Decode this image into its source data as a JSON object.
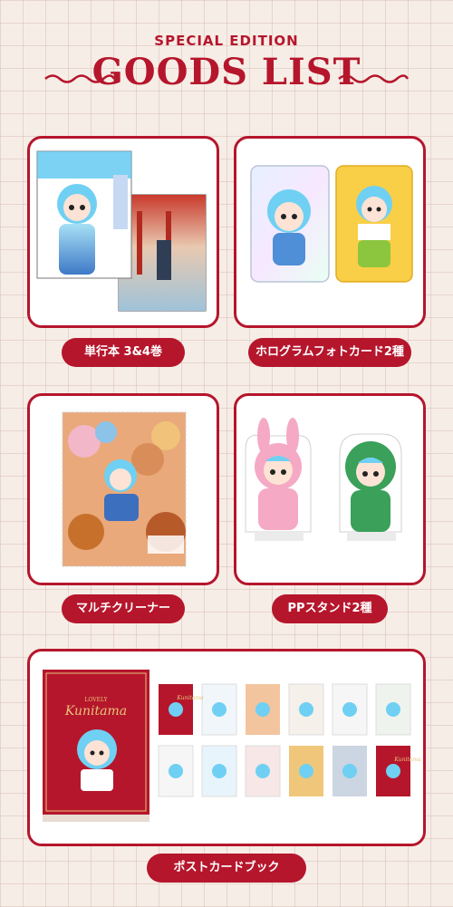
{
  "header": {
    "subtitle": "SPECIAL EDITION",
    "title": "GOODS LIST"
  },
  "items": [
    {
      "label": "単行本 3&4巻",
      "image": "manga-volumes-3-4"
    },
    {
      "label": "ホログラムフォトカード2種",
      "image": "hologram-photocards"
    },
    {
      "label": "マルチクリーナー",
      "image": "multi-cleaner-cloth"
    },
    {
      "label": "PPスタンド2種",
      "image": "pp-stands"
    },
    {
      "label": "ポストカードブック",
      "image": "postcard-book"
    }
  ],
  "postcard_book": {
    "cover_small_text": "LOVELY",
    "cover_title": "Kunitama"
  },
  "colors": {
    "accent": "#b5162c",
    "background": "#f6ede6",
    "card_background": "#ffffff"
  }
}
